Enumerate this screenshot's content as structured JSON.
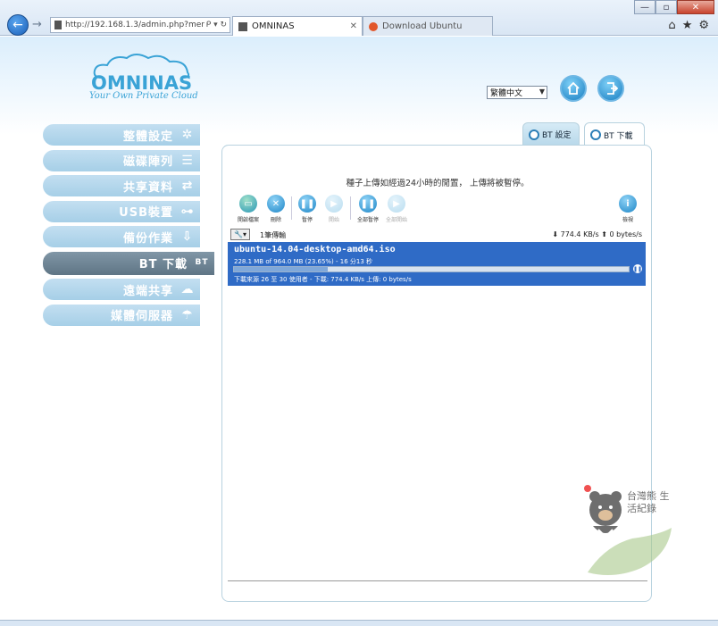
{
  "browser": {
    "url": "http://192.168.1.3/admin.php?mer",
    "tabs": [
      {
        "label": "OMNINAS",
        "active": true
      },
      {
        "label": "Download Ubuntu",
        "active": false
      }
    ],
    "win_minimize": "—",
    "win_maximize": "▫",
    "win_close": "✕",
    "home_glyph": "⌂",
    "fav_glyph": "★",
    "tools_glyph": "⚙",
    "addr_tail": "ᑭ ▾ ↻"
  },
  "brand": {
    "logo_text": "OMNINAS",
    "tagline": "Your Own Private Cloud"
  },
  "header": {
    "language": "繁體中文"
  },
  "sidebar": {
    "items": [
      {
        "label": "整體設定",
        "icon": "settings-icon",
        "glyph": "✲"
      },
      {
        "label": "磁碟陣列",
        "icon": "disk-array-icon",
        "glyph": "☰"
      },
      {
        "label": "共享資料",
        "icon": "share-arrows-icon",
        "glyph": "⇄"
      },
      {
        "label": "USB裝置",
        "icon": "usb-icon",
        "glyph": "⊶"
      },
      {
        "label": "備份作業",
        "icon": "backup-icon",
        "glyph": "⇩"
      },
      {
        "label": "BT 下載",
        "icon": "bt-download-icon",
        "glyph": "BT",
        "active": true
      },
      {
        "label": "遠端共享",
        "icon": "remote-share-icon",
        "glyph": "☁"
      },
      {
        "label": "媒體伺服器",
        "icon": "media-server-icon",
        "glyph": "☂"
      }
    ]
  },
  "panel": {
    "tabs": [
      {
        "label": "BT 設定"
      },
      {
        "label": "BT 下載"
      }
    ],
    "notice": "種子上傳如經過24小時的閒置， 上傳將被暫停。",
    "toolbar": {
      "open_torrent": "開啟檔案",
      "delete": "刪除",
      "pause": "暫停",
      "start": "開始",
      "pause_all": "全部暫停",
      "start_all": "全部開始",
      "info": "檢視"
    },
    "list": {
      "count": "1筆傳輸",
      "speed": "⬇ 774.4 KB/s  ⬆ 0 bytes/s",
      "torrents": [
        {
          "name": "ubuntu-14.04-desktop-amd64.iso",
          "info": "228.1 MB of 964.0 MB (23.65%) - 16 分13 秒",
          "progress": 0.2365,
          "peers": "下載來源 26 至 30 使用者 - 下載: 774.4 KB/s 上傳: 0 bytes/s"
        }
      ]
    }
  },
  "watermark": {
    "text": "台灣熊 生活紀錄"
  }
}
